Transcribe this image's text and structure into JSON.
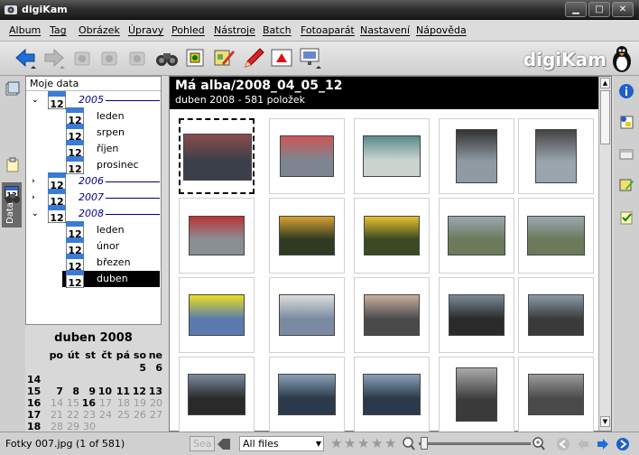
{
  "window": {
    "title": "digiKam"
  },
  "menu": [
    "Album",
    "Tag",
    "Obrázek",
    "Úpravy",
    "Pohled",
    "Nástroje",
    "Batch",
    "Fotoaparát",
    "Nastavení",
    "Nápověda"
  ],
  "toolbar": {
    "logo": "digiKam"
  },
  "sidebar_left": {
    "tab_label": "Data"
  },
  "tree": {
    "header": "Moje data",
    "calendar_icon_label": "12",
    "items": [
      {
        "label": "2005",
        "kind": "year",
        "expanded": true
      },
      {
        "label": "leden",
        "kind": "month"
      },
      {
        "label": "srpen",
        "kind": "month"
      },
      {
        "label": "říjen",
        "kind": "month"
      },
      {
        "label": "prosinec",
        "kind": "month"
      },
      {
        "label": "2006",
        "kind": "year",
        "expanded": false
      },
      {
        "label": "2007",
        "kind": "year",
        "expanded": false
      },
      {
        "label": "2008",
        "kind": "year",
        "expanded": true
      },
      {
        "label": "leden",
        "kind": "month"
      },
      {
        "label": "únor",
        "kind": "month"
      },
      {
        "label": "březen",
        "kind": "month"
      },
      {
        "label": "duben",
        "kind": "month",
        "selected": true
      }
    ]
  },
  "calendar": {
    "title": "duben 2008",
    "weekdays": [
      "po",
      "út",
      "st",
      "čt",
      "pá",
      "so",
      "ne"
    ],
    "weeks": [
      {
        "num": "",
        "days": [
          "",
          "",
          "",
          "",
          "",
          "5",
          "6"
        ]
      },
      {
        "num": "14",
        "days": [
          "",
          "",
          "",
          "",
          "",
          "",
          ""
        ]
      },
      {
        "num": "15",
        "days": [
          "7",
          "8",
          "9",
          "10",
          "11",
          "12",
          "13"
        ]
      },
      {
        "num": "16",
        "days": [
          "14",
          "15",
          "16",
          "17",
          "18",
          "19",
          "20"
        ]
      },
      {
        "num": "17",
        "days": [
          "21",
          "22",
          "23",
          "24",
          "25",
          "26",
          "27"
        ]
      },
      {
        "num": "18",
        "days": [
          "28",
          "29",
          "30",
          "",
          "",
          "",
          ""
        ]
      }
    ]
  },
  "album": {
    "title": "Má alba/2008_04_05_12",
    "subtitle": "duben 2008 - 581 položek"
  },
  "status": {
    "text": "Fotky 007.jpg (1 of 581)",
    "search_label": "Sea",
    "filter": "All files"
  },
  "colors": {
    "titlebar": "#2c2c2c",
    "header": "#000000",
    "accent": "#1e6fd9",
    "year": "#00008b"
  }
}
